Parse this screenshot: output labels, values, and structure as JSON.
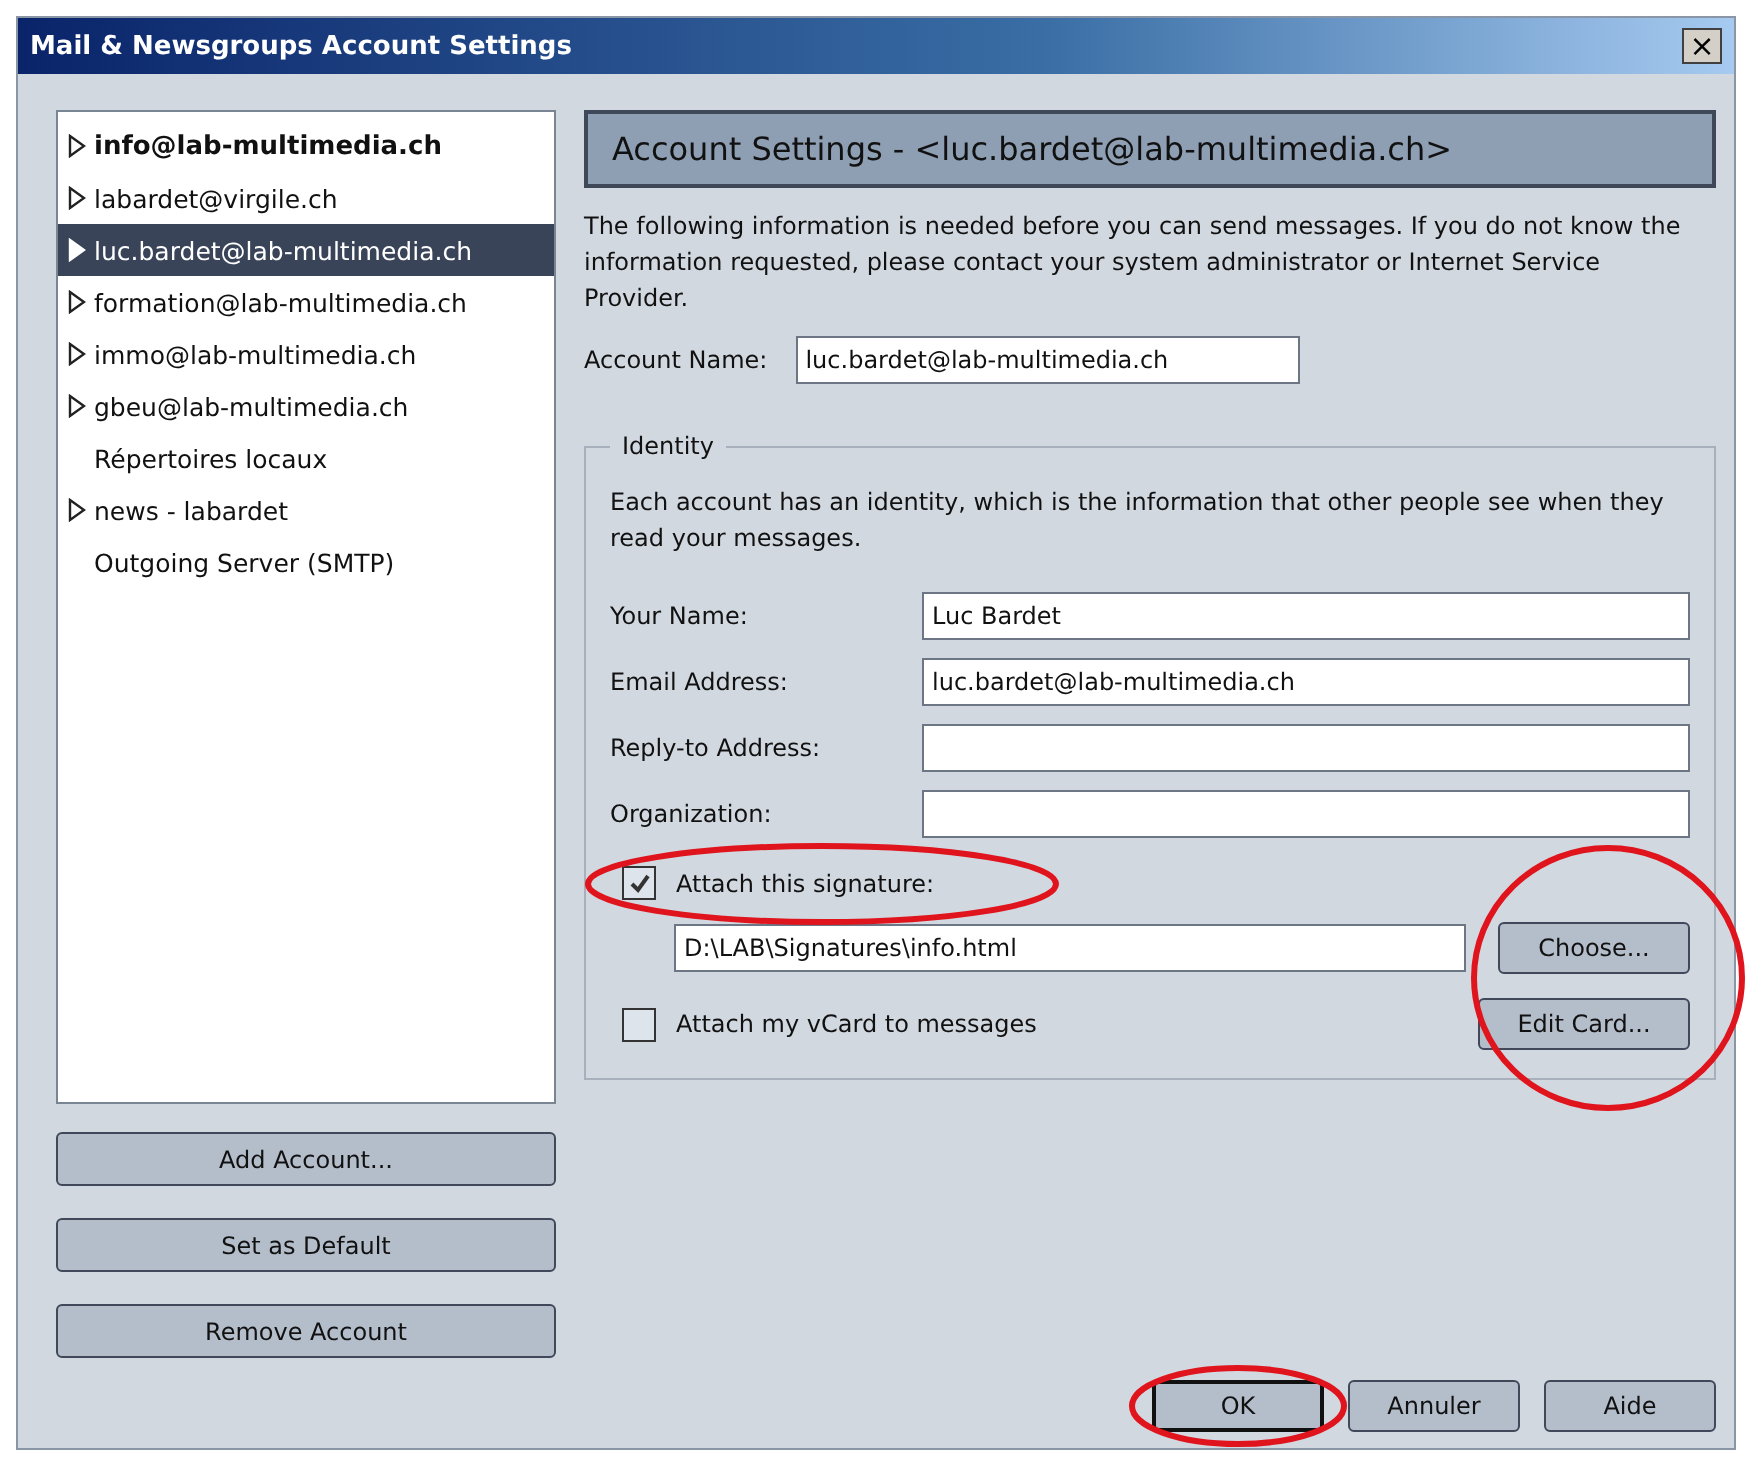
{
  "window": {
    "title": "Mail & Newsgroups Account Settings",
    "close": "×"
  },
  "accounts": [
    {
      "label": "info@lab-multimedia.ch",
      "kind": "account",
      "default": true,
      "selected": false
    },
    {
      "label": "labardet@virgile.ch",
      "kind": "account",
      "default": false,
      "selected": false
    },
    {
      "label": "luc.bardet@lab-multimedia.ch",
      "kind": "account",
      "default": false,
      "selected": true
    },
    {
      "label": "formation@lab-multimedia.ch",
      "kind": "account",
      "default": false,
      "selected": false
    },
    {
      "label": "immo@lab-multimedia.ch",
      "kind": "account",
      "default": false,
      "selected": false
    },
    {
      "label": "gbeu@lab-multimedia.ch",
      "kind": "account",
      "default": false,
      "selected": false
    },
    {
      "label": "Répertoires locaux",
      "kind": "plain",
      "default": false,
      "selected": false
    },
    {
      "label": "news - labardet",
      "kind": "account",
      "default": false,
      "selected": false
    },
    {
      "label": "Outgoing Server (SMTP)",
      "kind": "plain",
      "default": false,
      "selected": false
    }
  ],
  "account_buttons": [
    "Add Account...",
    "Set as Default",
    "Remove Account"
  ],
  "panel": {
    "header": "Account Settings - <luc.bardet@lab-multimedia.ch>",
    "intro": "The following information is needed before you can send messages. If you do not know the information requested, please contact your system administrator or Internet Service Provider.",
    "account_name": {
      "label": "Account Name:",
      "value": "luc.bardet@lab-multimedia.ch"
    },
    "identity": {
      "title": "Identity",
      "description": "Each account has an identity, which is the information that other people see when they read your messages.",
      "fields": [
        {
          "label": "Your Name:",
          "value": "Luc Bardet"
        },
        {
          "label": "Email Address:",
          "value": "luc.bardet@lab-multimedia.ch"
        },
        {
          "label": "Reply-to Address:"
        },
        {
          "label": "Organization:"
        }
      ],
      "signature": {
        "label": "Attach this signature:",
        "checked": true,
        "path": "D:\\LAB\\Signatures\\info.html",
        "button": "Choose..."
      },
      "vcard": {
        "label": "Attach my vCard to messages",
        "checked": false,
        "button": "Edit Card..."
      }
    }
  },
  "dialog_buttons": [
    {
      "label": "OK",
      "default": true
    },
    {
      "label": "Annuler",
      "default": false
    },
    {
      "label": "Aide",
      "default": false
    }
  ]
}
